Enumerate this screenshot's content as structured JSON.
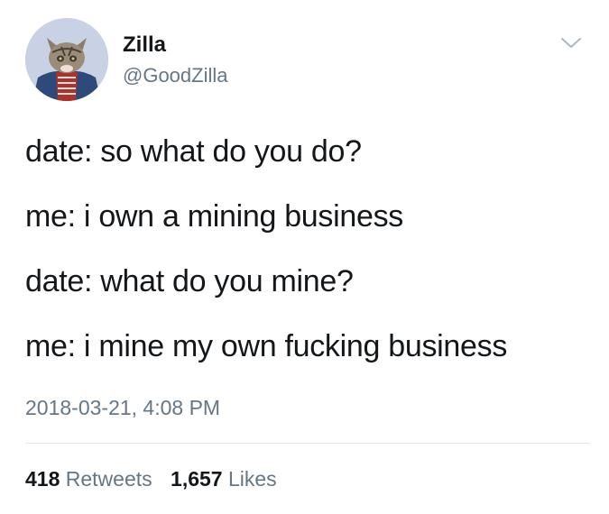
{
  "user": {
    "display_name": "Zilla",
    "handle": "@GoodZilla"
  },
  "tweet": {
    "lines": [
      "date: so what do you do?",
      "me: i own a mining business",
      "date: what do you mine?",
      "me: i mine my own fucking business"
    ],
    "timestamp": "2018-03-21, 4:08 PM"
  },
  "stats": {
    "retweets_count": "418",
    "retweets_label": "Retweets",
    "likes_count": "1,657",
    "likes_label": "Likes"
  },
  "icons": {
    "menu": "chevron-down-icon",
    "avatar": "cat-avatar"
  },
  "colors": {
    "text": "#14171a",
    "secondary": "#657786",
    "divider": "#e1e8ed"
  }
}
